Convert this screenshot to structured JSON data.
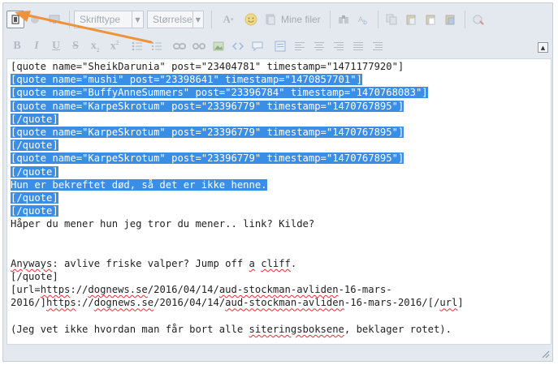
{
  "toolbar": {
    "font_family_label": "Skrifttype",
    "font_size_label": "Størrelse",
    "my_files_label": "Mine filer",
    "collapse_symbol": "▲",
    "dropdown_symbol": "▼"
  },
  "editor": {
    "lines": [
      {
        "segments": [
          {
            "text": "[quote name=\"SheikDarunia\" post=\"23404781\" timestamp=\"1471177920\"]"
          }
        ]
      },
      {
        "selected": true,
        "segments": [
          {
            "text": "[quote name=\"mushi\" post=\"23398641\" timestamp=\"1470857701\"]"
          }
        ]
      },
      {
        "selected": true,
        "segments": [
          {
            "text": "[quote name=\"BuffyAnneSummers\" post=\"23396784\" timestamp=\"1470768083\"]"
          }
        ]
      },
      {
        "selected": true,
        "segments": [
          {
            "text": "[quote name=\"KarpeSkrotum\" post=\"23396779\" timestamp=\"1470767895\"]"
          }
        ]
      },
      {
        "selected": true,
        "segments": [
          {
            "text": "[/quote]"
          }
        ]
      },
      {
        "selected": true,
        "segments": [
          {
            "text": "[quote name=\"KarpeSkrotum\" post=\"23396779\" timestamp=\"1470767895\"]"
          }
        ]
      },
      {
        "selected": true,
        "segments": [
          {
            "text": "[/quote]"
          }
        ]
      },
      {
        "selected": true,
        "segments": [
          {
            "text": "[quote name=\"KarpeSkrotum\" post=\"23396779\" timestamp=\"1470767895\"]"
          }
        ]
      },
      {
        "selected": true,
        "segments": [
          {
            "text": "[/quote]"
          }
        ]
      },
      {
        "selected": true,
        "segments": [
          {
            "text": "Hun er bekreftet død, så det er ikke henne."
          }
        ]
      },
      {
        "selected": true,
        "segments": [
          {
            "text": "[/quote]"
          }
        ]
      },
      {
        "selected": true,
        "segments": [
          {
            "text": "[/quote]"
          }
        ]
      },
      {
        "segments": [
          {
            "text": "Håper du mener hun jeg tror du mener.. link? Kilde?"
          }
        ]
      },
      {
        "segments": [
          {
            "text": ""
          }
        ]
      },
      {
        "segments": [
          {
            "text": ""
          }
        ]
      },
      {
        "segments": [
          {
            "text": "Anyways",
            "sq": true
          },
          {
            "text": ": avlive friske valper? Jump off "
          },
          {
            "text": "a",
            "sq": true
          },
          {
            "text": " "
          },
          {
            "text": "cliff",
            "sq": true
          },
          {
            "text": "."
          }
        ]
      },
      {
        "segments": [
          {
            "text": "[/quote]"
          }
        ]
      },
      {
        "segments": [
          {
            "text": "[url="
          },
          {
            "text": "https",
            "sq": true
          },
          {
            "text": "://"
          },
          {
            "text": "dognews.se",
            "sq": true
          },
          {
            "text": "/2016/04/14/"
          },
          {
            "text": "aud-stockman-avliden",
            "sq": true
          },
          {
            "text": "-16-mars-"
          }
        ]
      },
      {
        "segments": [
          {
            "text": "2016/]"
          },
          {
            "text": "https",
            "sq": true
          },
          {
            "text": "://"
          },
          {
            "text": "dognews.se",
            "sq": true
          },
          {
            "text": "/2016/04/14/"
          },
          {
            "text": "aud-stockman-avliden",
            "sq": true
          },
          {
            "text": "-16-mars-2016/[/"
          },
          {
            "text": "url",
            "sq": true
          },
          {
            "text": "]"
          }
        ]
      },
      {
        "segments": [
          {
            "text": ""
          }
        ]
      },
      {
        "segments": [
          {
            "text": "(Jeg vet ikke hvordan man får bort alle "
          },
          {
            "text": "siteringsboksene",
            "sq": true
          },
          {
            "text": ", beklager rotet)."
          }
        ]
      }
    ]
  },
  "annotation": {
    "arrow_color": "#f0923a"
  },
  "colors": {
    "selection": "#3a8ee6",
    "toolbar_bg": "#e4e9ef",
    "spellcheck": "#e03030"
  }
}
